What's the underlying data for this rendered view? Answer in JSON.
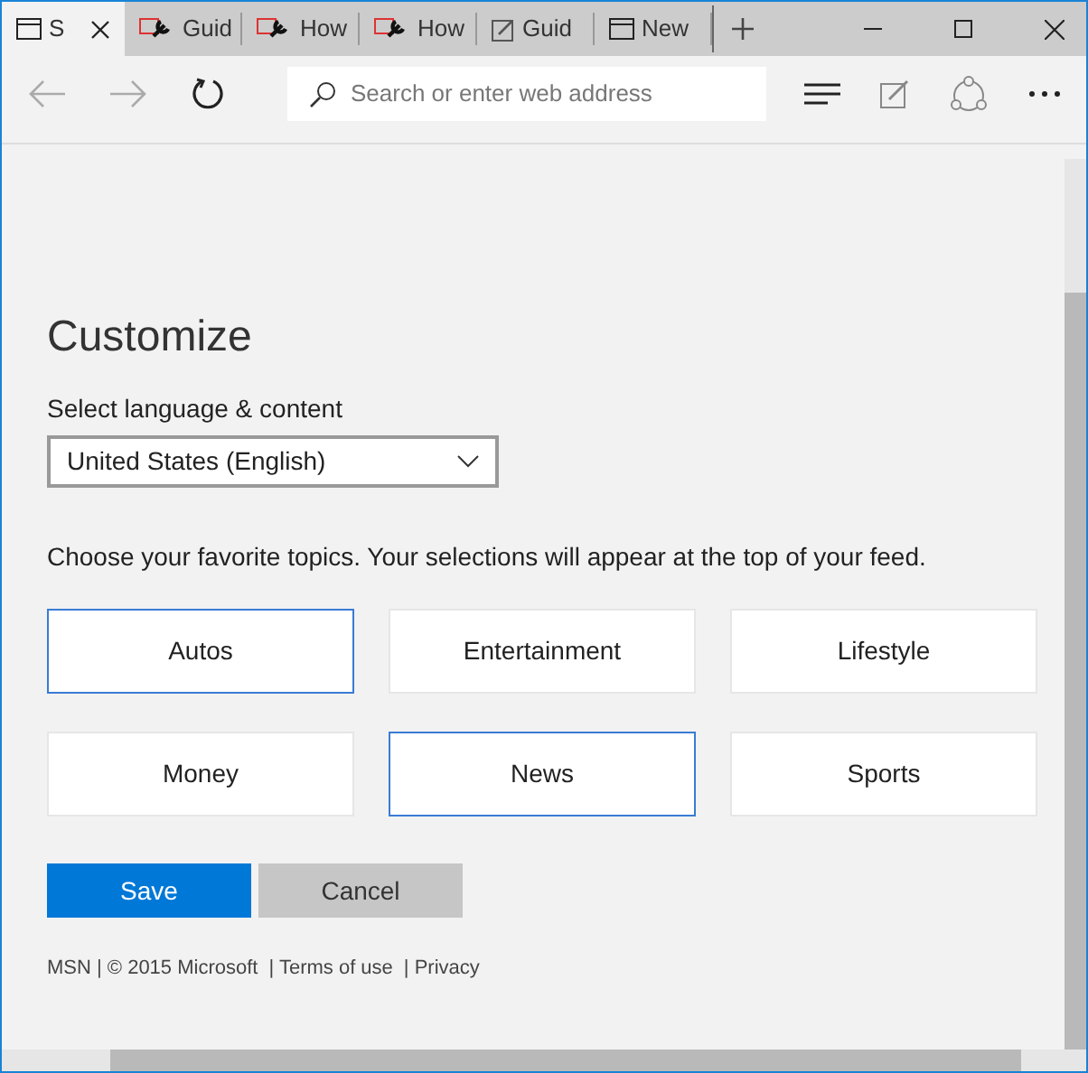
{
  "tabs": [
    {
      "label": "S",
      "kind": "page",
      "selected": true
    },
    {
      "label": "Guid",
      "kind": "tool",
      "selected": false
    },
    {
      "label": "How",
      "kind": "tool",
      "selected": false
    },
    {
      "label": "How",
      "kind": "tool",
      "selected": false
    },
    {
      "label": "Guid",
      "kind": "note",
      "selected": false
    },
    {
      "label": "New",
      "kind": "page",
      "selected": false
    }
  ],
  "address_bar": {
    "placeholder": "Search or enter web address"
  },
  "title": "Customize",
  "language": {
    "label": "Select language & content",
    "value": "United States (English)"
  },
  "topics_prompt": "Choose your favorite topics. Your selections will appear at the top of your feed.",
  "topics": [
    {
      "label": "Autos",
      "selected": true
    },
    {
      "label": "Entertainment",
      "selected": false
    },
    {
      "label": "Lifestyle",
      "selected": false
    },
    {
      "label": "Money",
      "selected": false
    },
    {
      "label": "News",
      "selected": true
    },
    {
      "label": "Sports",
      "selected": false
    }
  ],
  "buttons": [
    {
      "label": "Save",
      "kind": "primary"
    },
    {
      "label": "Cancel",
      "kind": "secondary"
    }
  ],
  "footer": {
    "copyright": "MSN | © 2015 Microsoft",
    "links": [
      "| Terms of use",
      "| Privacy"
    ]
  }
}
